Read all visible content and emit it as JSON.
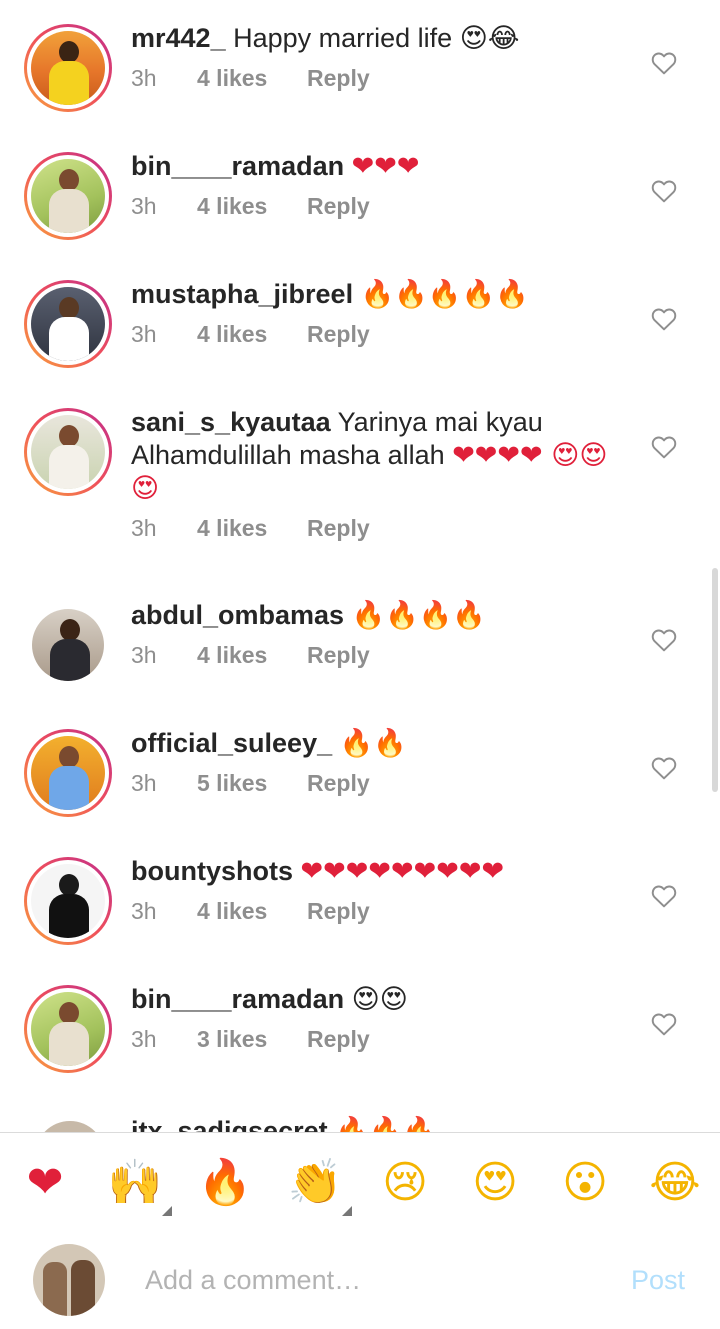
{
  "comments": [
    {
      "username": "mr442_",
      "text": "Happy married life ",
      "emoji": "😍😂",
      "time": "3h",
      "likes": "4 likes",
      "reply": "Reply"
    },
    {
      "username": "bin____ramadan",
      "text": "",
      "emoji": "❤❤❤",
      "time": "3h",
      "likes": "4 likes",
      "reply": "Reply"
    },
    {
      "username": "mustapha_jibreel",
      "text": "",
      "emoji": "🔥🔥🔥🔥🔥",
      "time": "3h",
      "likes": "4 likes",
      "reply": "Reply"
    },
    {
      "username": "sani_s_kyautaa",
      "text": "Yarinya mai kyau Alhamdulillah masha allah ",
      "emoji": "❤❤❤❤ 😍😍😍",
      "time": "3h",
      "likes": "4 likes",
      "reply": "Reply"
    },
    {
      "username": "abdul_ombamas",
      "text": "",
      "emoji": "🔥🔥🔥🔥",
      "time": "3h",
      "likes": "4 likes",
      "reply": "Reply"
    },
    {
      "username": "official_suleey_",
      "text": "",
      "emoji": "🔥🔥",
      "time": "3h",
      "likes": "5 likes",
      "reply": "Reply"
    },
    {
      "username": "bountyshots",
      "text": "",
      "emoji": "❤❤❤❤❤❤❤❤❤",
      "time": "3h",
      "likes": "4 likes",
      "reply": "Reply"
    },
    {
      "username": "bin____ramadan",
      "text": "",
      "emoji": "😍😍",
      "time": "3h",
      "likes": "3 likes",
      "reply": "Reply"
    }
  ],
  "partial_comment": {
    "username": "itx_sadiqsecret",
    "emoji": "🔥🔥🔥"
  },
  "emoji_bar": [
    {
      "name": "red-heart",
      "glyph": "❤"
    },
    {
      "name": "raising-hands",
      "glyph": "🙌"
    },
    {
      "name": "fire",
      "glyph": "🔥"
    },
    {
      "name": "clapping-hands",
      "glyph": "👏"
    },
    {
      "name": "crying-face",
      "glyph": "😢"
    },
    {
      "name": "heart-eyes",
      "glyph": "😍"
    },
    {
      "name": "surprised-face",
      "glyph": "😮"
    },
    {
      "name": "laughing-face",
      "glyph": "😂"
    }
  ],
  "composer": {
    "placeholder": "Add a comment…",
    "post_label": "Post"
  },
  "colors": {
    "accent": "#0095f6",
    "post_disabled": "#b2dffc",
    "meta": "#8e8e8e",
    "text": "#262626",
    "heart_red": "#e0203a",
    "story_ring_start": "#f9a43d",
    "story_ring_end": "#c02c8d"
  }
}
